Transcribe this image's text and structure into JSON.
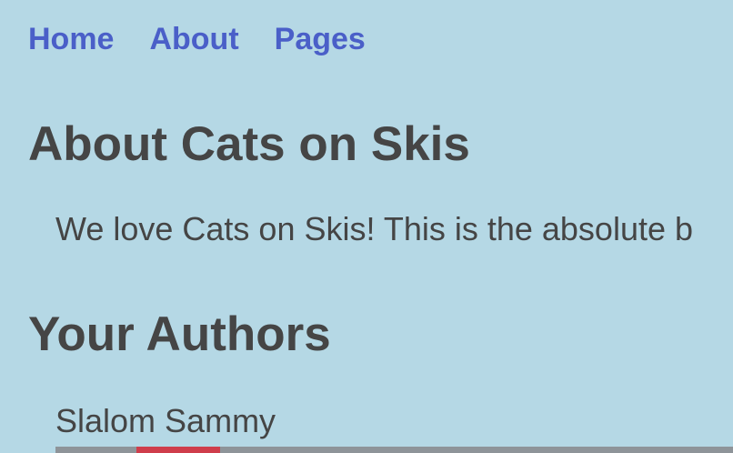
{
  "nav": {
    "items": [
      "Home",
      "About",
      "Pages"
    ]
  },
  "about": {
    "title": "About Cats on Skis",
    "intro": "We love Cats on Skis! This is the absolute b"
  },
  "authors": {
    "title": "Your Authors",
    "items": [
      {
        "name": "Slalom Sammy"
      }
    ]
  }
}
